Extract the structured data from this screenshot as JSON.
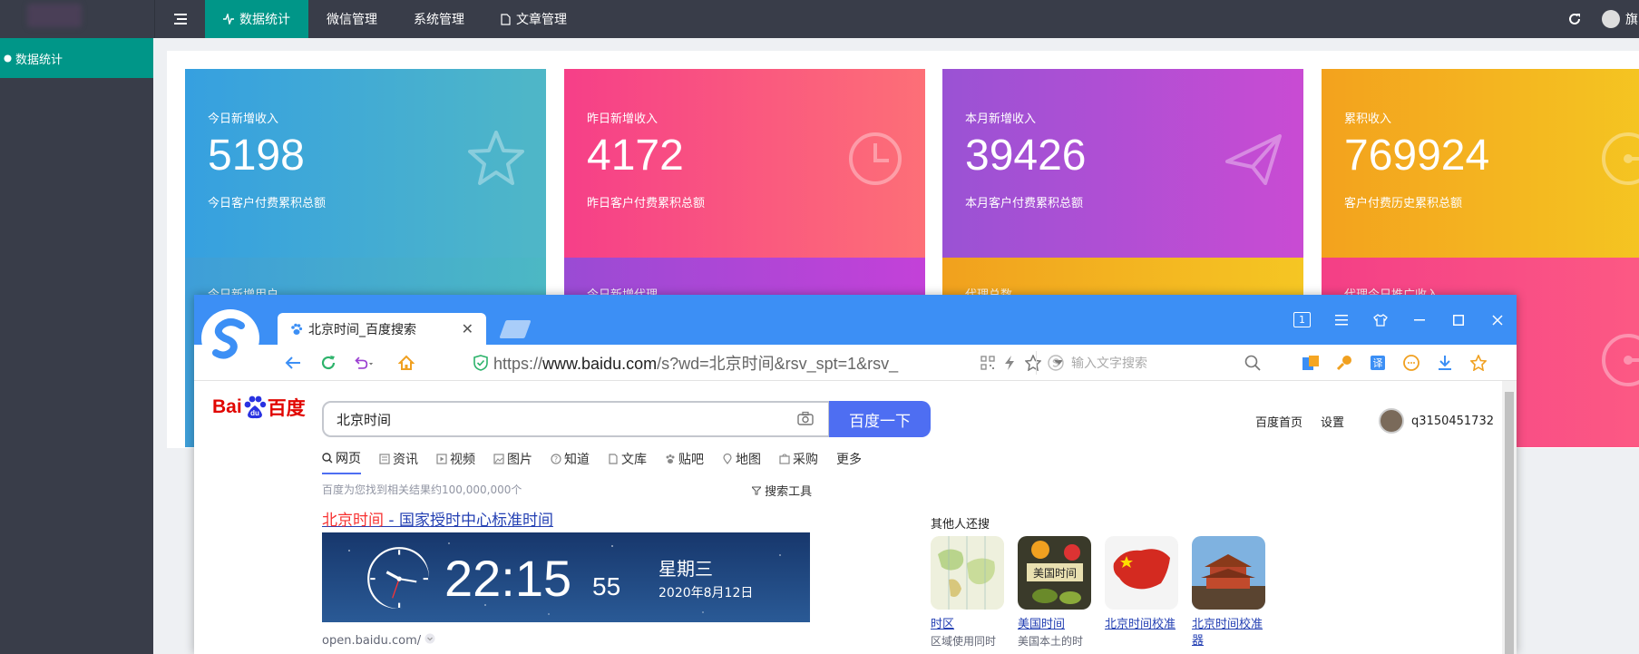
{
  "topbar": {
    "nav": [
      {
        "label": "数据统计",
        "icon": "activity-icon",
        "active": true
      },
      {
        "label": "微信管理",
        "icon": "",
        "active": false
      },
      {
        "label": "系统管理",
        "icon": "",
        "active": false
      },
      {
        "label": "文章管理",
        "icon": "document-icon",
        "active": false
      }
    ],
    "user_name": "旗"
  },
  "sidebar": {
    "items": [
      {
        "label": "数据统计",
        "active": true
      }
    ]
  },
  "cards": [
    {
      "label": "今日新增收入",
      "value": "5198",
      "sub": "今日客户付费累积总额",
      "icon": "star-icon"
    },
    {
      "label": "昨日新增收入",
      "value": "4172",
      "sub": "昨日客户付费累积总额",
      "icon": "clock-icon"
    },
    {
      "label": "本月新增收入",
      "value": "39426",
      "sub": "本月客户付费累积总额",
      "icon": "paper-plane-icon"
    },
    {
      "label": "累积收入",
      "value": "769924",
      "sub": "客户付费历史累积总额",
      "icon": "clock-icon"
    }
  ],
  "cards_row2": [
    {
      "label": "今日新增用户"
    },
    {
      "label": "今日新增代理"
    },
    {
      "label": "代理总数"
    },
    {
      "label": "代理今日推广收入"
    }
  ],
  "browser": {
    "tab_title": "北京时间_百度搜索",
    "tab_counter": "1",
    "url_scheme": "https://",
    "url_domain": "www.baidu.com",
    "url_path": "/s?wd=北京时间&rsv_spt=1&rsv_",
    "search_placeholder": "输入文字搜索"
  },
  "baidu": {
    "query": "北京时间",
    "search_button": "百度一下",
    "links": {
      "home": "百度首页",
      "settings": "设置",
      "username": "q3150451732"
    },
    "tabs": [
      "网页",
      "资讯",
      "视频",
      "图片",
      "知道",
      "文库",
      "贴吧",
      "地图",
      "采购",
      "更多"
    ],
    "result_count": "百度为您找到相关结果约100,000,000个",
    "tools_label": "搜索工具",
    "result_title_hl": "北京时间",
    "result_title_rest": " - 国家授时中心标准时间",
    "clock": {
      "time": "22:15",
      "seconds": "55",
      "weekday": "星期三",
      "date": "2020年8月12日"
    },
    "result_url": "open.baidu.com/",
    "others_title": "其他人还搜",
    "others": [
      {
        "name": "时区",
        "desc": "区域使用同时"
      },
      {
        "name": "美国时间",
        "desc": "美国本土的时"
      },
      {
        "name": "北京时间校准",
        "desc": ""
      },
      {
        "name": "北京时间校准器",
        "desc": ""
      }
    ]
  }
}
